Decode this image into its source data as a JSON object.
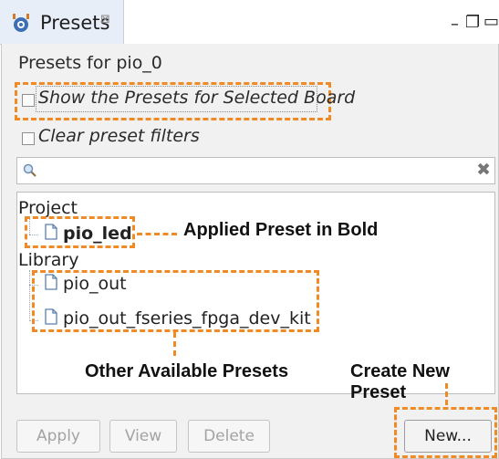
{
  "tab": {
    "title": "Presets",
    "close_glyph": "⊠",
    "icon": "presets-app-icon",
    "window_controls": {
      "minimize": "–",
      "restore": "❐",
      "maximize": "▭"
    }
  },
  "panel": {
    "presets_for": "Presets for pio_0",
    "show_presets_label": "Show the Presets for Selected Board",
    "show_presets_checked": false,
    "clear_filters_label": "Clear preset filters",
    "clear_filters_checked": false,
    "search": {
      "placeholder": "",
      "value": "",
      "clear_glyph": "✖"
    }
  },
  "tree": {
    "project_label": "Project",
    "project_items": [
      {
        "label": "pio_led",
        "bold": true
      }
    ],
    "library_label": "Library",
    "library_items": [
      {
        "label": "pio_out"
      },
      {
        "label": "pio_out_fseries_fpga_dev_kit"
      }
    ]
  },
  "annotations": {
    "applied": "Applied Preset in Bold",
    "other": "Other Available Presets",
    "create": "Create New Preset"
  },
  "buttons": {
    "apply": "Apply",
    "view": "View",
    "delete": "Delete",
    "new": "New..."
  },
  "colors": {
    "annotation_accent": "#f08a24",
    "tab_background": "#e8eef8",
    "panel_background": "#f1f1f1"
  }
}
